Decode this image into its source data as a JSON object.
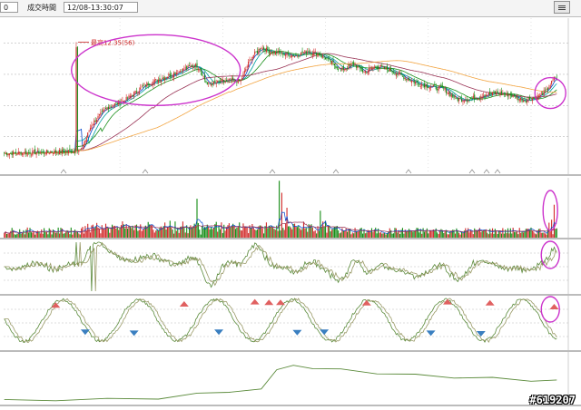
{
  "toolbar": {
    "code_text": "0",
    "time_label": "成交時間",
    "time_value": "12/08-13:30:07"
  },
  "watermark": "#619207",
  "chart_data": {
    "type": "line",
    "title": "",
    "annotations": [
      {
        "text": "最高12.35(56)",
        "ref": "price_panel.highest"
      }
    ],
    "colors": {
      "candle_up": "#d32f2f",
      "candle_down": "#1a8f1a",
      "ma5": "#0044cc",
      "ma10": "#00a0a0",
      "ma20": "#1a8f1a",
      "ma60": "#993355",
      "ma120": "#f2a440",
      "highlight_circle": "#cc33cc",
      "indicator_line_a": "#5a8a3a",
      "indicator_line_b": "#999966",
      "kd_cross_up": "#e06060",
      "kd_cross_down": "#3a7fc0"
    },
    "price_panel": {
      "ylim": [
        6.0,
        13.5
      ],
      "grid": true,
      "highest": {
        "value": 12.35,
        "bar": 56
      },
      "path_points": [
        [
          0,
          7.0
        ],
        [
          30,
          7.05
        ],
        [
          50,
          7.1
        ],
        [
          60,
          7.15
        ],
        [
          68,
          8.4
        ],
        [
          80,
          9.2
        ],
        [
          95,
          9.6
        ],
        [
          110,
          10.3
        ],
        [
          122,
          10.6
        ],
        [
          130,
          10.8
        ],
        [
          138,
          11.0
        ],
        [
          148,
          11.25
        ],
        [
          152,
          11.1
        ],
        [
          158,
          10.3
        ],
        [
          166,
          10.4
        ],
        [
          176,
          10.5
        ],
        [
          184,
          10.5
        ],
        [
          192,
          11.6
        ],
        [
          200,
          12.1
        ],
        [
          206,
          11.9
        ],
        [
          216,
          11.8
        ],
        [
          226,
          11.7
        ],
        [
          236,
          11.9
        ],
        [
          244,
          11.8
        ],
        [
          252,
          11.5
        ],
        [
          262,
          11.0
        ],
        [
          272,
          11.3
        ],
        [
          280,
          10.9
        ],
        [
          290,
          11.2
        ],
        [
          300,
          11.0
        ],
        [
          310,
          10.7
        ],
        [
          320,
          10.4
        ],
        [
          332,
          10.2
        ],
        [
          342,
          10.1
        ],
        [
          352,
          9.6
        ],
        [
          362,
          9.6
        ],
        [
          372,
          9.8
        ],
        [
          384,
          9.9
        ],
        [
          394,
          9.8
        ],
        [
          404,
          9.55
        ],
        [
          414,
          9.7
        ],
        [
          422,
          10.0
        ],
        [
          428,
          10.6
        ]
      ],
      "ma_periods": [
        5,
        10,
        20,
        60,
        120
      ]
    },
    "volume_panel": {
      "spikes": [
        [
          150,
          0.65
        ],
        [
          214,
          0.95
        ],
        [
          216,
          0.75
        ],
        [
          220,
          0.5
        ],
        [
          246,
          0.45
        ],
        [
          424,
          0.25
        ],
        [
          426,
          0.3
        ],
        [
          428,
          0.55
        ]
      ]
    },
    "indicator_panel_1": {
      "ylim": [
        0,
        100
      ],
      "grid": true
    },
    "indicator_panel_2": {
      "ylim": [
        0,
        100
      ],
      "grid": true,
      "cross_up_markers": [
        [
          40,
          0.12
        ],
        [
          140,
          0.1
        ],
        [
          195,
          0.06
        ],
        [
          206,
          0.07
        ],
        [
          215,
          0.07
        ],
        [
          282,
          0.08
        ],
        [
          345,
          0.06
        ],
        [
          378,
          0.08
        ],
        [
          428,
          0.15
        ]
      ],
      "cross_down_markers": [
        [
          63,
          0.62
        ],
        [
          101,
          0.64
        ],
        [
          167,
          0.62
        ],
        [
          228,
          0.63
        ],
        [
          249,
          0.62
        ],
        [
          332,
          0.64
        ],
        [
          371,
          0.65
        ]
      ]
    },
    "indicator_panel_3": {
      "ylim": [
        0,
        100
      ],
      "grid": false,
      "line": [
        [
          0,
          8
        ],
        [
          40,
          9
        ],
        [
          80,
          10
        ],
        [
          120,
          12
        ],
        [
          150,
          20
        ],
        [
          175,
          25
        ],
        [
          200,
          28
        ],
        [
          212,
          68
        ],
        [
          225,
          73
        ],
        [
          240,
          70
        ],
        [
          262,
          66
        ],
        [
          290,
          60
        ],
        [
          320,
          56
        ],
        [
          350,
          52
        ],
        [
          380,
          50
        ],
        [
          410,
          46
        ],
        [
          430,
          45
        ]
      ]
    }
  }
}
